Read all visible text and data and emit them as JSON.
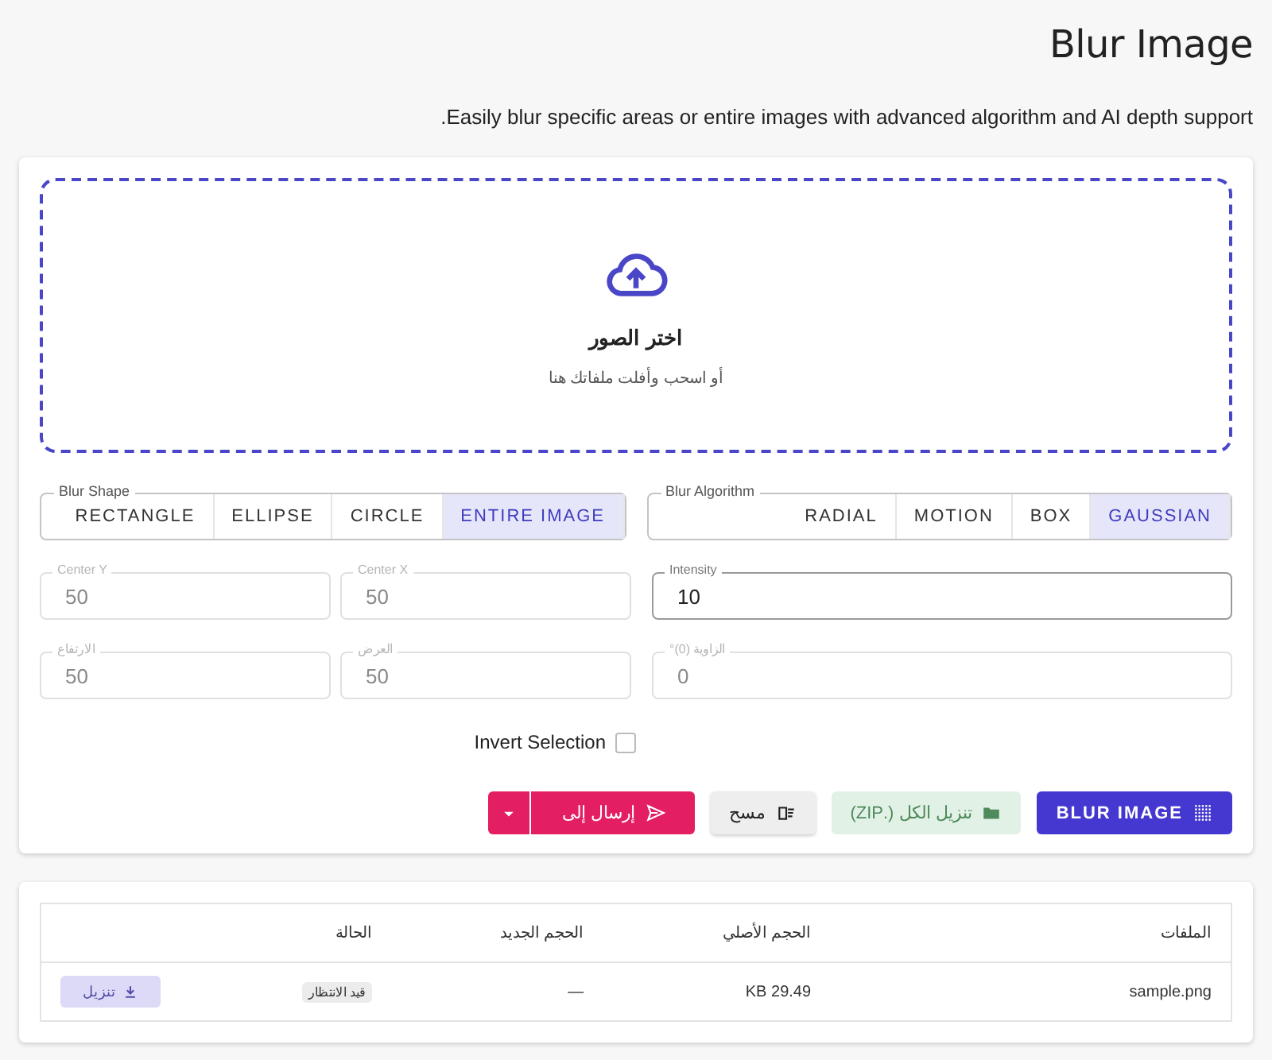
{
  "header": {
    "title": "Blur Image",
    "subtitle": "Easily blur specific areas or entire images with advanced algorithm and AI depth support."
  },
  "dropzone": {
    "title": "اختر الصور",
    "hint": "أو اسحب وأفلت ملفاتك هنا"
  },
  "groups": [
    {
      "label": "Blur Algorithm",
      "options": [
        {
          "label": "GAUSSIAN",
          "selected": true
        },
        {
          "label": "BOX",
          "selected": false
        },
        {
          "label": "MOTION",
          "selected": false
        },
        {
          "label": "RADIAL",
          "selected": false
        }
      ]
    },
    {
      "label": "Blur Shape",
      "options": [
        {
          "label": "ENTIRE IMAGE",
          "selected": true
        },
        {
          "label": "CIRCLE",
          "selected": false
        },
        {
          "label": "ELLIPSE",
          "selected": false
        },
        {
          "label": "RECTANGLE",
          "selected": false
        }
      ]
    }
  ],
  "fields": [
    {
      "label": "Intensity",
      "value": "10",
      "disabled": false
    },
    {
      "label": "Center X",
      "value": "50",
      "disabled": true
    },
    {
      "label": "Center Y",
      "value": "50",
      "disabled": true
    },
    {
      "label": "الزاوية (0)°",
      "value": "0",
      "disabled": true
    },
    {
      "label": "العرض",
      "value": "50",
      "disabled": true
    },
    {
      "label": "الارتفاع",
      "value": "50",
      "disabled": true
    }
  ],
  "invert": {
    "label": "Invert Selection",
    "checked": false
  },
  "buttons": [
    {
      "kind": "primary",
      "label": "BLUR IMAGE",
      "disabled": false
    },
    {
      "kind": "success",
      "label": "تنزيل الكل (.ZIP)",
      "disabled": true
    },
    {
      "kind": "neutral",
      "label": "مسح",
      "disabled": false
    },
    {
      "kind": "split",
      "label": "إرسال إلى",
      "disabled": false
    }
  ],
  "table": {
    "columns": [
      "الملفات",
      "الحجم الأصلي",
      "الحجم الجديد",
      "الحالة"
    ],
    "rows": [
      {
        "file": "sample.png",
        "original": "29.49 KB",
        "new": "—",
        "status": "قيد الانتظار",
        "action": "تنزيل",
        "action_disabled": true
      }
    ]
  }
}
